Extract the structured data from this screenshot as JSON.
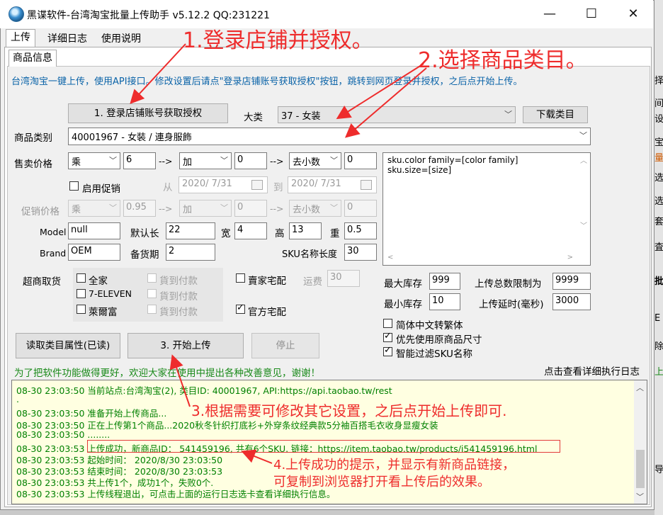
{
  "window": {
    "title": "黑谍软件-台湾淘宝批量上传助手 v5.12.2 QQ:231221"
  },
  "tabs": [
    "上传",
    "详细日志",
    "使用说明"
  ],
  "subtab": "商品信息",
  "info_text": "台湾淘宝一键上传，使用API接口。修改设置后请点\"登录店铺账号获取授权\"按钮，跳转到网页登录并授权，之后点开始上传。",
  "buttons": {
    "login": "1. 登录店铺账号获取授权",
    "download": "下载类目",
    "read_attr": "读取类目属性(已读)",
    "start": "3. 开始上传",
    "stop": "停止"
  },
  "labels": {
    "category_major": "大类",
    "product_category": "商品类别",
    "sale_price": "售卖价格",
    "arrow": "-->",
    "enable_promo": "启用促销",
    "from": "从",
    "to": "到",
    "promo_price": "促销价格",
    "model": "Model",
    "default_length": "默认长",
    "width": "宽",
    "height": "高",
    "weight": "重",
    "brand": "Brand",
    "stock_period": "备货期",
    "sku_name_len": "SKU名称长度",
    "supermarket": "超商取货",
    "familymart": "全家",
    "seven": "7-ELEVEN",
    "hilife": "萊爾富",
    "cod": "貨到付款",
    "seller_home": "賣家宅配",
    "freight": "运费",
    "official_home": "官方宅配",
    "max_stock": "最大库存",
    "min_stock": "最小库存",
    "upload_limit": "上传总数限制为",
    "upload_delay": "上传延时(毫秒)",
    "s2t": "简体中文转繁体",
    "orig_size": "优先使用原商品尺寸",
    "filter_sku": "智能过滤SKU名称"
  },
  "values": {
    "category_major": "37 - 女装",
    "product_category": "40001967 - 女裝 / 連身服飾",
    "op1": "乘",
    "val1": "6",
    "op2": "加",
    "val2": "0",
    "op3": "去小数",
    "val3": "0",
    "date_from": "2020/ 7/31",
    "date_to": "2020/ 7/31",
    "p_op1": "乘",
    "p_val1": "0.95",
    "p_op2": "加",
    "p_val2": "0",
    "p_op3": "去小数",
    "p_val3": "0",
    "model": "null",
    "length": "22",
    "width": "4",
    "height": "13",
    "weight": "0.5",
    "brand": "OEM",
    "stock_period": "2",
    "sku_len": "30",
    "sku_text_1": "sku.color family=[color family]",
    "sku_text_2": "sku.size=[size]",
    "freight": "30",
    "max_stock": "999",
    "min_stock": "10",
    "upload_limit": "9999",
    "upload_delay": "3000"
  },
  "feedback_text": "为了把软件功能做得更好，欢迎大家在使用中提出各种改善意见，谢谢！",
  "log_link": "点击查看详细执行日志",
  "log_lines": [
    "08-30 23:03:50  当前站点:台湾淘宝(2), 类目ID: 40001967, API:https://api.taobao.tw/rest",
    ".",
    "08-30 23:03:50  准备开始上传商品...",
    "08-30 23:03:50  正在上传第1个商品...2020秋冬针织打底衫+外穿条纹经典款5分袖百搭毛衣收身显瘦女装",
    "08-30 23:03:50  ........",
    "08-30 23:03:53  上传成功，新商品ID： 541459196, 共有6个SKU. 链接：https://item.taobao.tw/products/i541459196.html",
    "08-30 23:03:53  起始时间： 2020/8/30 23:03:50",
    "08-30 23:03:53  结束时间： 2020/8/30 23:03:53",
    "08-30 23:03:53  共上传1个，成功1个，失败0个.",
    "08-30 23:03:53  上传线程退出，可点击上面的运行日志选卡查看详细执行信息。"
  ],
  "annotations": {
    "a1": "1.登录店铺并授权。",
    "a2": "2.选择商品类目。",
    "a3": "3.根据需要可修改其它设置，之后点开始上传即可.",
    "a4_1": "4.上传成功的提示，并显示有新商品链接，",
    "a4_2": "可复制到浏览器打开看上传后的效果。"
  },
  "right_edge": [
    "择",
    "\"",
    "间",
    "设",
    "宝",
    "量",
    "选",
    "选",
    "套",
    "査",
    "批",
    "E",
    "除",
    "上",
    "导"
  ]
}
